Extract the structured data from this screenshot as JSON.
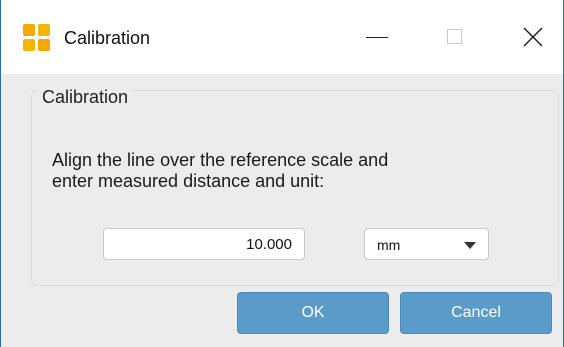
{
  "window": {
    "title": "Calibration",
    "controls": {
      "minimize": "minimize",
      "maximize": "maximize",
      "close": "close"
    }
  },
  "dialog": {
    "group_title": "Calibration",
    "instruction_line1": "Align the line over the reference scale and",
    "instruction_line2": "enter measured distance and unit:",
    "distance_value": "10.000",
    "unit_selected": "mm",
    "ok_label": "OK",
    "cancel_label": "Cancel"
  },
  "colors": {
    "button_bg": "#5b9bc9",
    "client_bg": "#ececec",
    "app_icon": "#f4b400"
  }
}
